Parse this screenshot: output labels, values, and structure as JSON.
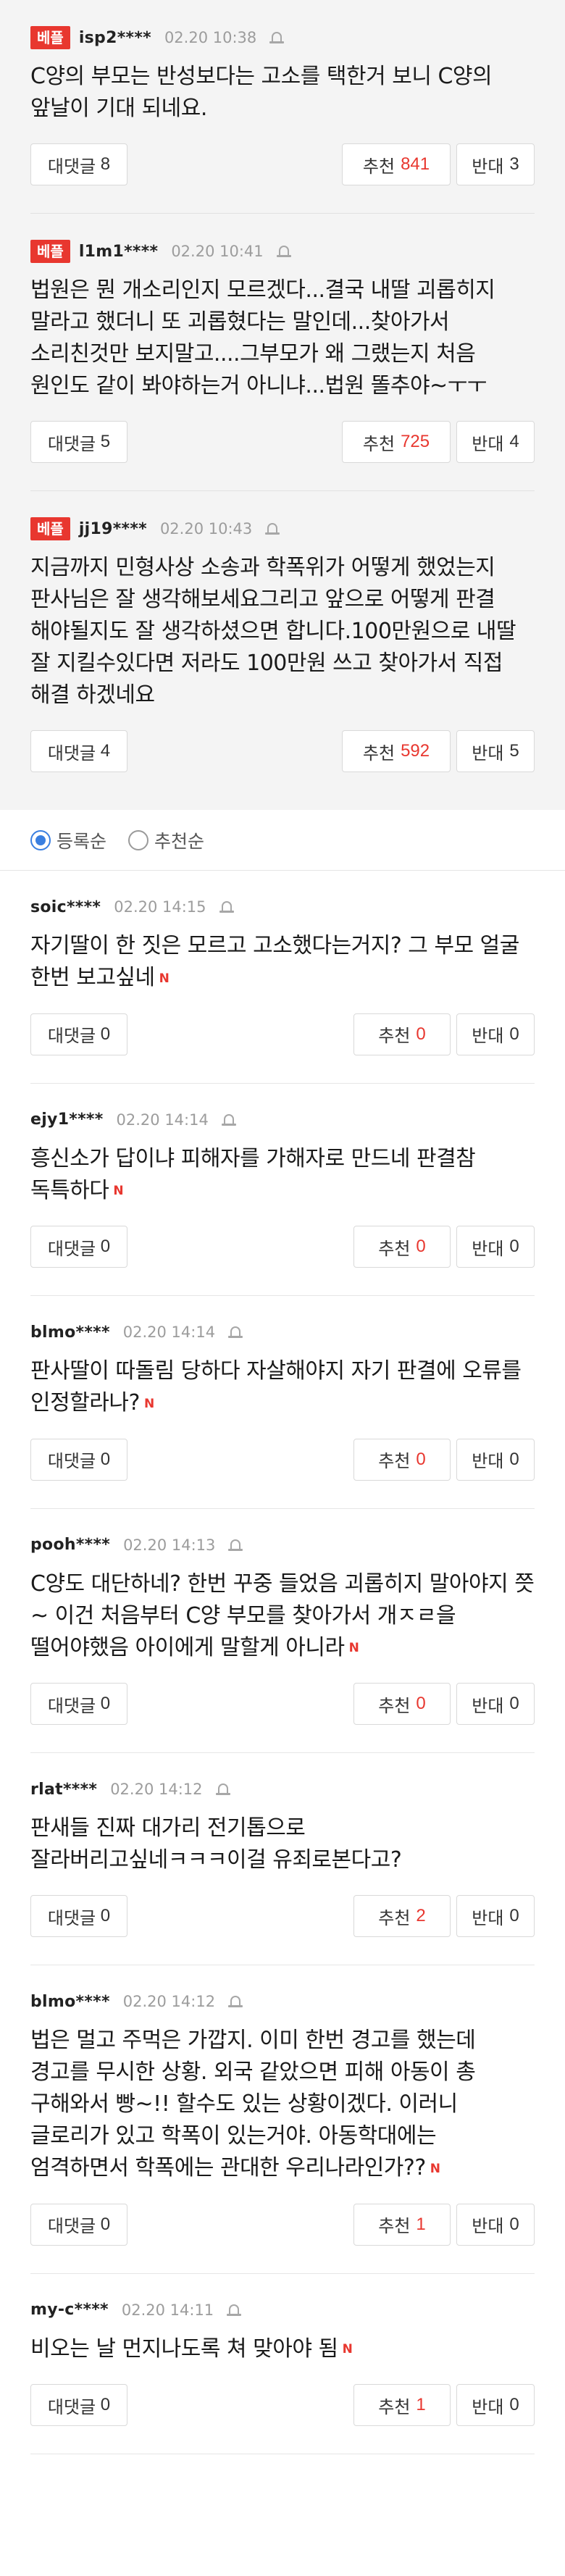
{
  "best_badge": "베플",
  "report_icon": "bell-icon",
  "labels": {
    "reply": "대댓글",
    "up": "추천",
    "down": "반대"
  },
  "best_comments": [
    {
      "user": "isp2****",
      "date": "02.20 10:38",
      "text": "C양의 부모는 반성보다는 고소를 택한거 보니 C양의 앞날이 기대 되네요.",
      "replies": "8",
      "up": "841",
      "down": "3"
    },
    {
      "user": "l1m1****",
      "date": "02.20 10:41",
      "text": "법원은 뭔 개소리인지 모르겠다...결국 내딸 괴롭히지 말라고 했더니 또 괴롭혔다는 말인데...찾아가서 소리친것만 보지말고....그부모가 왜 그랬는지 처음 원인도 같이 봐야하는거 아니냐...법원 똘추야~ㅜㅜ",
      "replies": "5",
      "up": "725",
      "down": "4"
    },
    {
      "user": "jj19****",
      "date": "02.20 10:43",
      "text": "지금까지 민형사상 소송과 학폭위가 어떻게 했었는지 판사님은 잘 생각해보세요그리고 앞으로 어떻게 판결 해야될지도 잘 생각하셨으면 합니다.100만원으로 내딸 잘 지킬수있다면 저라도 100만원 쓰고 찾아가서 직접 해결 하겠네요",
      "replies": "4",
      "up": "592",
      "down": "5"
    }
  ],
  "sort": {
    "by_date": "등록순",
    "by_recommend": "추천순",
    "selected": "등록순"
  },
  "comments": [
    {
      "user": "soic****",
      "date": "02.20 14:15",
      "text": "자기딸이 한 짓은 모르고 고소했다는거지? 그 부모 얼굴 한번 보고싶네",
      "new": "N",
      "replies": "0",
      "up": "0",
      "down": "0"
    },
    {
      "user": "ejy1****",
      "date": "02.20 14:14",
      "text": "흥신소가 답이냐 피해자를 가해자로 만드네 판결참 독특하다",
      "new": "N",
      "replies": "0",
      "up": "0",
      "down": "0"
    },
    {
      "user": "blmo****",
      "date": "02.20 14:14",
      "text": "판사딸이 따돌림 당하다 자살해야지 자기 판결에 오류를 인정할라나?",
      "new": "N",
      "replies": "0",
      "up": "0",
      "down": "0"
    },
    {
      "user": "pooh****",
      "date": "02.20 14:13",
      "text": "C양도 대단하네? 한번 꾸중 들었음 괴롭히지 말아야지 쯧~ 이건 처음부터 C양 부모를 찾아가서 개ㅈㄹ을 떨어야했음 아이에게 말할게 아니라",
      "new": "N",
      "replies": "0",
      "up": "0",
      "down": "0"
    },
    {
      "user": "rlat****",
      "date": "02.20 14:12",
      "text": "판새들 진짜 대가리 전기톱으로 잘라버리고싶네ㅋㅋㅋ이걸 유죄로본다고?",
      "new": "",
      "replies": "0",
      "up": "2",
      "down": "0"
    },
    {
      "user": "blmo****",
      "date": "02.20 14:12",
      "text": "법은 멀고 주먹은 가깝지. 이미 한번 경고를 했는데 경고를 무시한 상황. 외국 같았으면 피해 아동이 총 구해와서 빵~!! 할수도 있는 상황이겠다. 이러니 글로리가 있고 학폭이 있는거야. 아동학대에는 엄격하면서 학폭에는 관대한 우리나라인가??",
      "new": "N",
      "replies": "0",
      "up": "1",
      "down": "0"
    },
    {
      "user": "my-c****",
      "date": "02.20 14:11",
      "text": "비오는 날 먼지나도록 쳐 맞아야 됨",
      "new": "N",
      "replies": "0",
      "up": "1",
      "down": "0"
    }
  ]
}
